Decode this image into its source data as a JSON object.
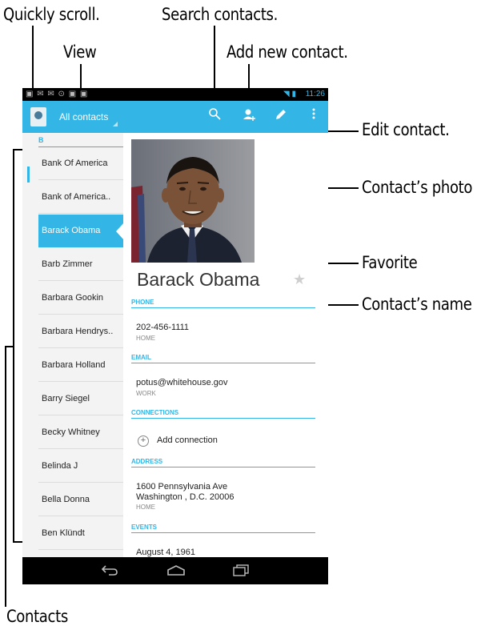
{
  "callouts": {
    "quickly_scroll": "Quickly scroll.",
    "search_contacts": "Search contacts.",
    "view": "View",
    "add_new_contact": "Add new contact.",
    "edit_contact": "Edit contact.",
    "contacts_photo": "Contact’s photo",
    "favorite": "Favorite",
    "contacts_name": "Contact’s name",
    "contacts": "Contacts"
  },
  "status_bar": {
    "icons": "▣ ✉ ✉ ⊙ ▣ ▣",
    "time": "11:26",
    "system_icons": "◥ ▮"
  },
  "action_bar": {
    "view_label": "All contacts",
    "search_icon": "search-icon",
    "add_icon": "add-contact-icon",
    "edit_icon": "pencil-icon",
    "overflow_icon": "overflow-menu-icon"
  },
  "list": {
    "section_header": "B",
    "items": [
      "Bank Of America",
      "Bank of America..",
      "Barack Obama",
      "Barb Zimmer",
      "Barbara Gookin",
      "Barbara Hendrys..",
      "Barbara Holland",
      "Barry Siegel",
      "Becky Whitney",
      "Belinda J",
      "Bella Donna",
      "Ben Klündt"
    ],
    "selected_index": 2
  },
  "detail": {
    "name": "Barack Obama",
    "favorite_icon": "star-icon",
    "phone_header": "PHONE",
    "phone_value": "202-456-1111",
    "phone_type": "HOME",
    "email_header": "EMAIL",
    "email_value": "potus@whitehouse.gov",
    "email_type": "WORK",
    "connections_header": "CONNECTIONS",
    "add_connection": "Add connection",
    "address_header": "ADDRESS",
    "address_line1": "1600 Pennsylvania Ave",
    "address_line2": "Washington , D.C. 20006",
    "address_type": "HOME",
    "events_header": "EVENTS",
    "event_value": "August 4, 1961"
  },
  "colors": {
    "accent": "#33b5e5",
    "list_bg": "#f3f3f3",
    "nav_bg": "#000000"
  }
}
